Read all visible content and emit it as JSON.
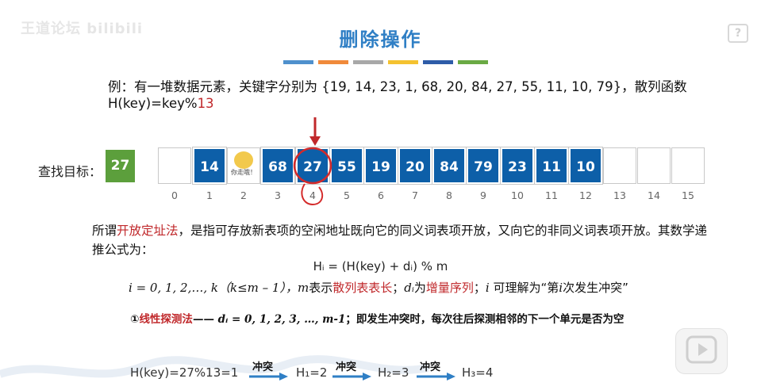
{
  "watermark": "王道论坛 bilibili",
  "help_icon": "?",
  "title": "删除操作",
  "color_bars": [
    "#4f90cd",
    "#f08a3a",
    "#a8a8a8",
    "#f4c230",
    "#2e5ca8",
    "#6aaa44"
  ],
  "example": {
    "prefix": "例：有一堆数据元素，关键字分别为 {19, 14, 23, 1, 68, 20, 84, 27, 55, 11, 10, 79}，散列函数",
    "hash_prefix": "H(key)=key%",
    "hash_mod": "13"
  },
  "search": {
    "label": "查找目标：",
    "target": "27"
  },
  "table": {
    "cells": [
      "",
      "14",
      "你走哦！",
      "68",
      "27",
      "55",
      "19",
      "20",
      "84",
      "79",
      "23",
      "11",
      "10",
      "",
      "",
      ""
    ],
    "indices": [
      "0",
      "1",
      "2",
      "3",
      "4",
      "5",
      "6",
      "7",
      "8",
      "9",
      "10",
      "11",
      "12",
      "13",
      "14",
      "15"
    ]
  },
  "paragraph": {
    "p1": "所谓",
    "p2": "开放定址法",
    "p3": "，是指可存放新表项的空闲地址既向它的同义词表项开放，又向它的非同义词表项开放。其数学递推公式为："
  },
  "formula": "Hᵢ = (H(key) + dᵢ) % m",
  "definitions": {
    "i_range": "i = 0, 1, 2,…, k（k≤m – 1），",
    "m_var": "m",
    "m_desc": "表示",
    "m_term": "散列表表长",
    "sep1": "；",
    "d_var": "dᵢ",
    "d_desc": "为",
    "d_term": "增量序列",
    "sep2": "；",
    "i_var": "i",
    "i_desc": "可理解为“第",
    "i_var2": "i",
    "i_desc2": "次发生冲突”"
  },
  "linear": {
    "num": "①",
    "name": "线性探测法",
    "dash": "——",
    "di": "dᵢ = 0, 1, 2, 3, …, m-1",
    "desc": "；即发生冲突时，每次往后探测相邻的下一个单元是否为空"
  },
  "bottom": {
    "h0_prefix": "H(key)=",
    "h0_rest": "27%13=1",
    "clash": "冲突",
    "h1": "H₁=2",
    "h2": "H₂=3",
    "h3": "H₃=4"
  }
}
